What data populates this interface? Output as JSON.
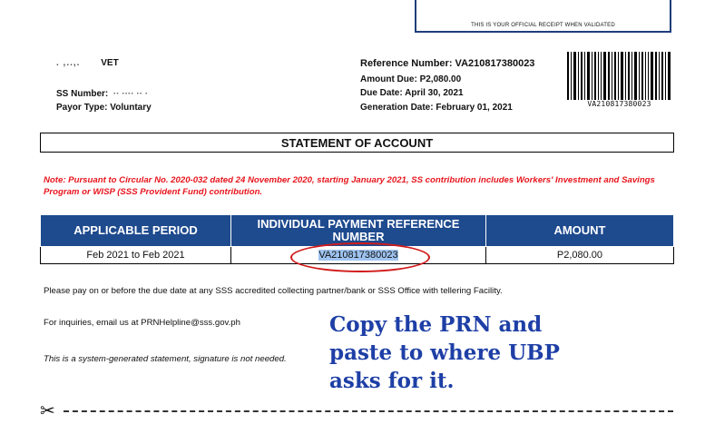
{
  "receipt": {
    "note": "THIS IS YOUR OFFICIAL RECEIPT WHEN VALIDATED"
  },
  "payor": {
    "name_partial": "VET",
    "name_redacted": ". ,..,.",
    "ss_number_label": "SS Number:",
    "ss_number_redacted": " ·· ···· ·· ·",
    "payor_type_label": "Payor Type:",
    "payor_type_value": "Voluntary"
  },
  "billing": {
    "reference_label": "Reference Number:",
    "reference_value": "VA210817380023",
    "amount_due_label": "Amount Due:",
    "amount_due_value": "P2,080.00",
    "due_date_label": "Due Date:",
    "due_date_value": "April 30, 2021",
    "generation_date_label": "Generation Date:",
    "generation_date_value": "February 01, 2021",
    "barcode_text": "VA210817380023"
  },
  "title": "STATEMENT OF ACCOUNT",
  "note": "Note: Pursuant to Circular No. 2020-032 dated 24 November 2020, starting January 2021, SS contribution includes Workers' Investment and Savings Program or WISP (SSS Provident Fund) contribution.",
  "table": {
    "headers": [
      "APPLICABLE PERIOD",
      "INDIVIDUAL PAYMENT REFERENCE NUMBER",
      "AMOUNT"
    ],
    "rows": [
      {
        "period": "Feb 2021 to Feb 2021",
        "prn": "VA210817380023",
        "amount": "P2,080.00"
      }
    ]
  },
  "instructions": {
    "pay_note": "Please pay on or before the due date at any SSS accredited collecting partner/bank or SSS Office with tellering Facility.",
    "inquiries": "For inquiries, email us at PRNHelpline@sss.gov.ph",
    "system_generated": "This is a system-generated statement, signature is not needed."
  },
  "annotation": {
    "callout_line1": "Copy the PRN and",
    "callout_line2": "paste to where UBP",
    "callout_line3": "asks for it.",
    "ellipse_color": "#d11a1a",
    "callout_color": "#1e3fa6"
  },
  "colors": {
    "header_bg": "#1e4a8e",
    "note_red": "#e8141c",
    "prn_highlight": "#9ec3f0"
  },
  "icons": {
    "cut": "scissors-icon"
  }
}
